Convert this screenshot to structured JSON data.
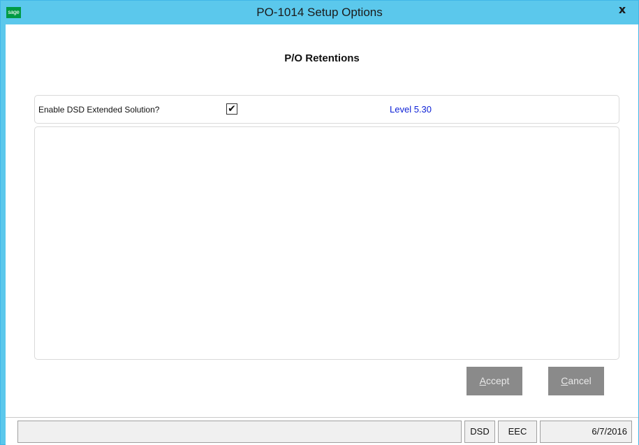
{
  "window": {
    "title": "PO-1014 Setup Options",
    "app_icon_label": "sage",
    "close_label": "x"
  },
  "heading": "P/O Retentions",
  "option": {
    "label": "Enable DSD Extended Solution?",
    "checked": true,
    "check_mark": "✔",
    "level_text": "Level  5.30"
  },
  "buttons": {
    "accept_first": "A",
    "accept_rest": "ccept",
    "cancel_first": "C",
    "cancel_rest": "ancel"
  },
  "statusbar": {
    "main": "",
    "dsd": "DSD",
    "eec": "EEC",
    "date": "6/7/2016"
  },
  "colors": {
    "titlebar": "#5bc8ec",
    "level_text": "#0b1fd6",
    "button_bg": "#8a8a8a",
    "sage_green": "#009a44"
  }
}
